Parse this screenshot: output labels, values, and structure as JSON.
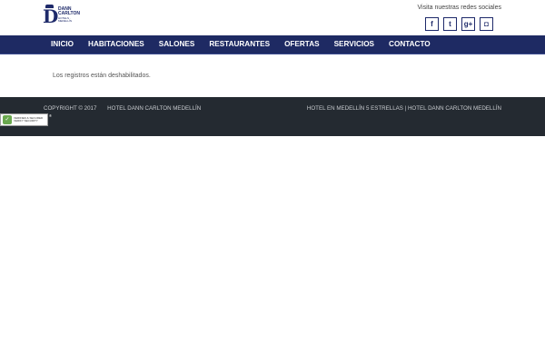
{
  "header": {
    "logo": {
      "name": "DANN CARLTON",
      "tagline": "HOTELS · MEDELLÍN"
    },
    "social_label": "Visita nuestras redes sociales",
    "social_icons": [
      {
        "name": "facebook-icon",
        "glyph": "f"
      },
      {
        "name": "twitter-icon",
        "glyph": "t"
      },
      {
        "name": "google-plus-icon",
        "glyph": "g+"
      },
      {
        "name": "instagram-icon",
        "glyph": "◘"
      }
    ]
  },
  "nav": {
    "items": [
      "INICIO",
      "HABITACIONES",
      "SALONES",
      "RESTAURANTES",
      "OFERTAS",
      "SERVICIOS",
      "CONTACTO"
    ]
  },
  "main": {
    "message": "Los registros están deshabilitados."
  },
  "footer": {
    "copyright": "COPYRIGHT © 2017",
    "hotel_name": "HOTEL DANN CARLTON MEDELLÍN",
    "right_text": "HOTEL EN MEDELLÍN 5 ESTRELLAS | HOTEL DANN CARLTON MEDELLÍN"
  },
  "badge": {
    "line1": "VERIFIED & SECURED",
    "line2": "VERIFY SECURITY",
    "registered": "®"
  },
  "colors": {
    "nav_bg": "#1e2a63",
    "footer_bg": "#242a31",
    "brand": "#1e2a6a"
  }
}
